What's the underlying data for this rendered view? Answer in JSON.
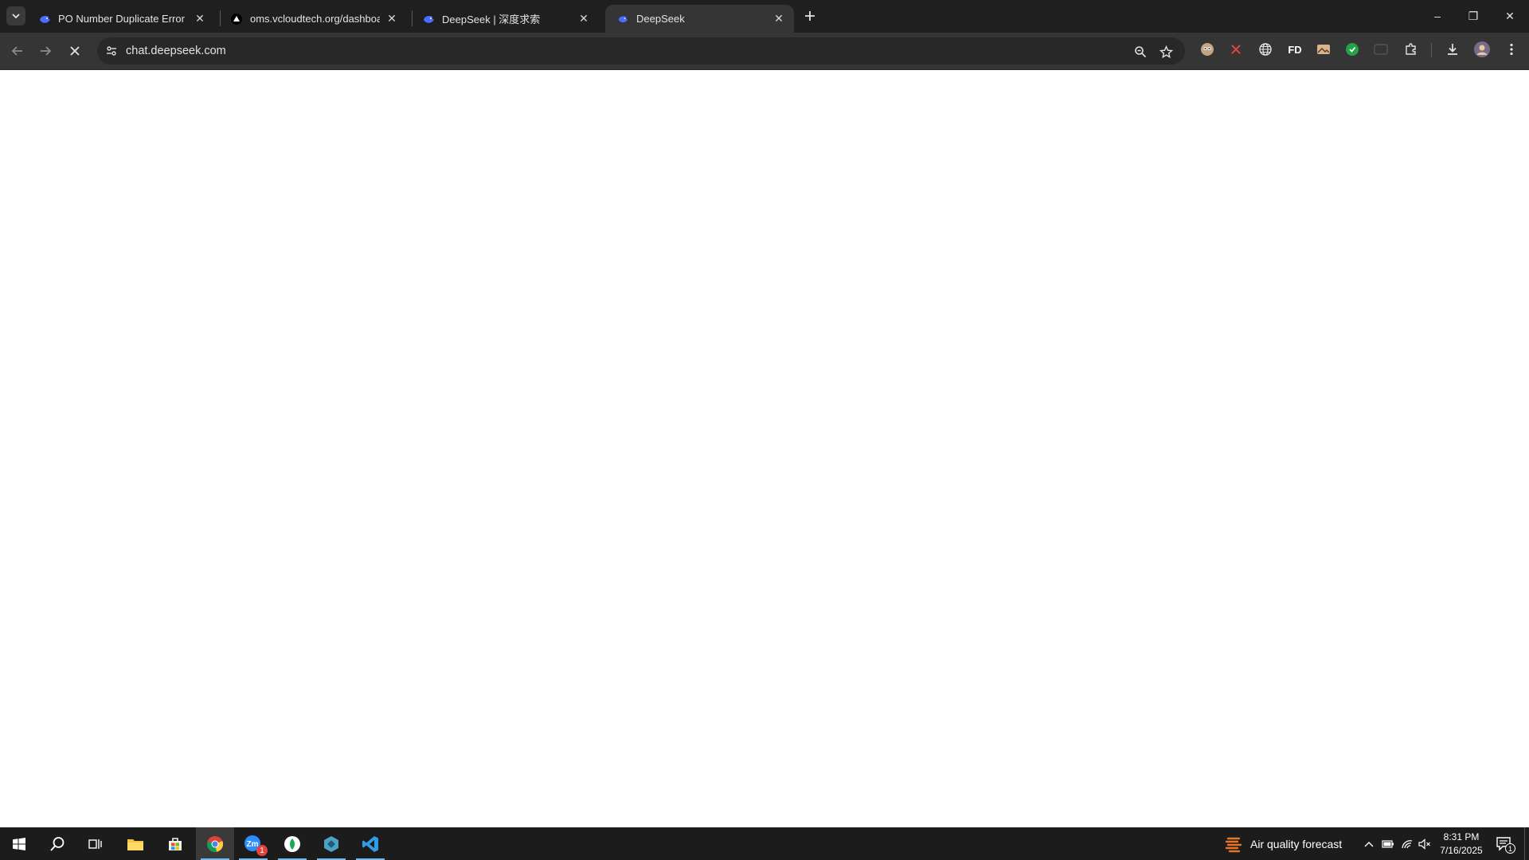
{
  "browser": {
    "tabs": [
      {
        "title": "PO Number Duplicate Error Exp",
        "icon": "deepseek-whale-icon",
        "active": false
      },
      {
        "title": "oms.vcloudtech.org/dashboard",
        "icon": "triangle-logo-icon",
        "active": false
      },
      {
        "title": "DeepSeek | 深度求索",
        "icon": "deepseek-whale-icon",
        "active": false
      },
      {
        "title": "DeepSeek",
        "icon": "deepseek-whale-icon",
        "active": true
      }
    ],
    "url": "chat.deepseek.com",
    "window_controls": {
      "minimize": "–",
      "restore": "❐",
      "close": "✕"
    },
    "extensions": [
      "avatar-extension-icon",
      "x-extension-icon",
      "globe-extension-icon",
      "fd-extension-icon",
      "image-extension-icon",
      "green-extension-icon",
      "cast-extension-icon",
      "puzzle-extensions-icon"
    ],
    "fd_label": "FD"
  },
  "taskbar": {
    "weather_text": "Air quality forecast",
    "time": "8:31 PM",
    "date": "7/16/2025",
    "zoom_badge": "1",
    "notif_badge": "1",
    "accent": "#76b9ed"
  }
}
